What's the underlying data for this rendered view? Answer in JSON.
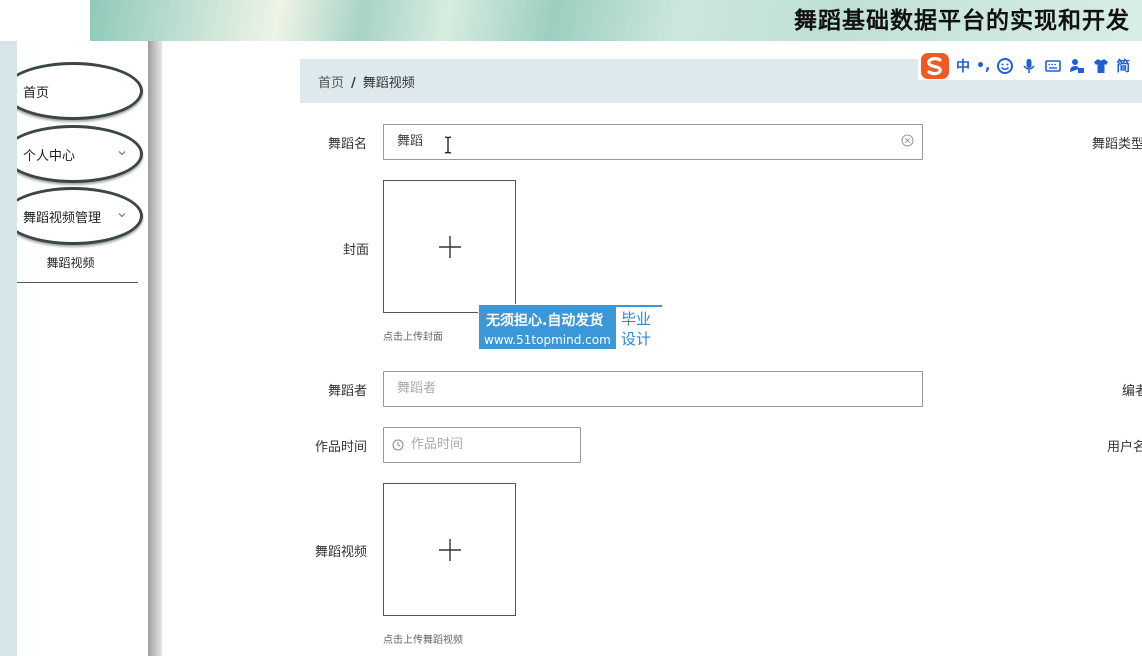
{
  "header": {
    "title": "舞蹈基础数据平台的实现和开发"
  },
  "sidebar": {
    "items": [
      {
        "label": "首页"
      },
      {
        "label": "个人中心"
      },
      {
        "label": "舞蹈视频管理"
      }
    ],
    "submenu": [
      {
        "label": "舞蹈视频"
      }
    ]
  },
  "breadcrumb": {
    "home": "首页",
    "separator": "/",
    "current": "舞蹈视频"
  },
  "ime": {
    "mode": "中",
    "punct": "•,",
    "label": "简"
  },
  "form": {
    "dance_name": {
      "label": "舞蹈名",
      "value": "舞蹈"
    },
    "cover": {
      "label": "封面",
      "hint": "点击上传封面"
    },
    "dancer": {
      "label": "舞蹈者",
      "placeholder": "舞蹈者"
    },
    "work_time": {
      "label": "作品时间",
      "placeholder": "作品时间"
    },
    "dance_video": {
      "label": "舞蹈视频",
      "hint": "点击上传舞蹈视频"
    },
    "right_labels": {
      "dance_type": "舞蹈类型",
      "editor": "编者",
      "username": "用户名"
    }
  },
  "watermark": {
    "line1": "无须担心.自动发货",
    "line2": "www.51topmind.com",
    "badge_top": "毕业",
    "badge_bottom": "设计"
  },
  "colors": {
    "accent": "#3c97d8",
    "breadcrumb_bg": "#dde9ec",
    "menu_border": "#3c4646"
  }
}
